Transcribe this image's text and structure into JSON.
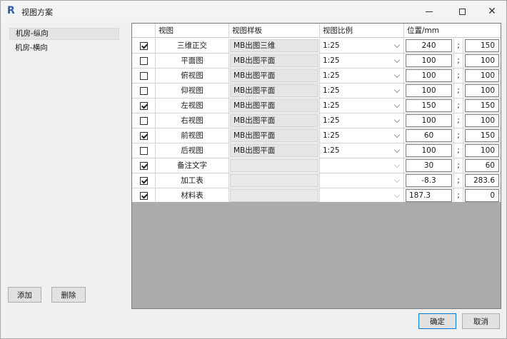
{
  "window": {
    "title": "视图方案",
    "app_icon_letter": "R"
  },
  "schemes": [
    {
      "label": "机房-纵向",
      "selected": true
    },
    {
      "label": "机房-横向",
      "selected": false
    }
  ],
  "buttons": {
    "add": "添加",
    "delete": "删除",
    "ok": "确定",
    "cancel": "取消"
  },
  "table": {
    "headers": {
      "check": "",
      "view": "视图",
      "template": "视图样板",
      "scale": "视图比例",
      "position": "位置/mm"
    },
    "separator": ";",
    "rows": [
      {
        "checked": true,
        "view": "三维正交",
        "template": "MB出图三维",
        "scale": "1:25",
        "x": "240",
        "y": "150"
      },
      {
        "checked": false,
        "view": "平面图",
        "template": "MB出图平面",
        "scale": "1:25",
        "x": "100",
        "y": "100"
      },
      {
        "checked": false,
        "view": "俯视图",
        "template": "MB出图平面",
        "scale": "1:25",
        "x": "100",
        "y": "100"
      },
      {
        "checked": false,
        "view": "仰视图",
        "template": "MB出图平面",
        "scale": "1:25",
        "x": "100",
        "y": "100"
      },
      {
        "checked": true,
        "view": "左视图",
        "template": "MB出图平面",
        "scale": "1:25",
        "x": "150",
        "y": "150"
      },
      {
        "checked": false,
        "view": "右视图",
        "template": "MB出图平面",
        "scale": "1:25",
        "x": "100",
        "y": "100"
      },
      {
        "checked": true,
        "view": "前视图",
        "template": "MB出图平面",
        "scale": "1:25",
        "x": "60",
        "y": "150"
      },
      {
        "checked": false,
        "view": "后视图",
        "template": "MB出图平面",
        "scale": "1:25",
        "x": "100",
        "y": "100"
      },
      {
        "checked": true,
        "view": "备注文字",
        "template": "",
        "scale": "",
        "x": "30",
        "y": "60"
      },
      {
        "checked": true,
        "view": "加工表",
        "template": "",
        "scale": "",
        "x": "-8.3",
        "y": "283.6"
      },
      {
        "checked": true,
        "view": "材料表",
        "template": "",
        "scale": "",
        "x": "187.3",
        "y": "0",
        "x_align": "left"
      }
    ]
  }
}
